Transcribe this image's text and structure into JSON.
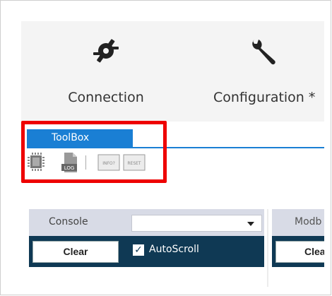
{
  "ribbon": {
    "connection_label": "Connection",
    "configuration_label": "Configuration *",
    "connection_icon": "plug-connection-icon",
    "configuration_icon": "wrench-icon"
  },
  "toolbox": {
    "tab_label": "ToolBox",
    "tools": [
      {
        "name": "chip-icon"
      },
      {
        "name": "log-file-icon",
        "text": "LOG"
      },
      {
        "name": "info-button-icon",
        "text": "INFO?"
      },
      {
        "name": "reset-button-icon",
        "text": "RESET"
      }
    ]
  },
  "console": {
    "title": "Console",
    "select_value": "",
    "clear_label": "Clear",
    "autoscroll_label": "AutoScroll",
    "autoscroll_checked": true
  },
  "modbus": {
    "title": "Modb",
    "clear_label": "Clea"
  },
  "colors": {
    "accent": "#1a7fd4",
    "console_bar": "#0f3954",
    "highlight": "#ee0000"
  }
}
